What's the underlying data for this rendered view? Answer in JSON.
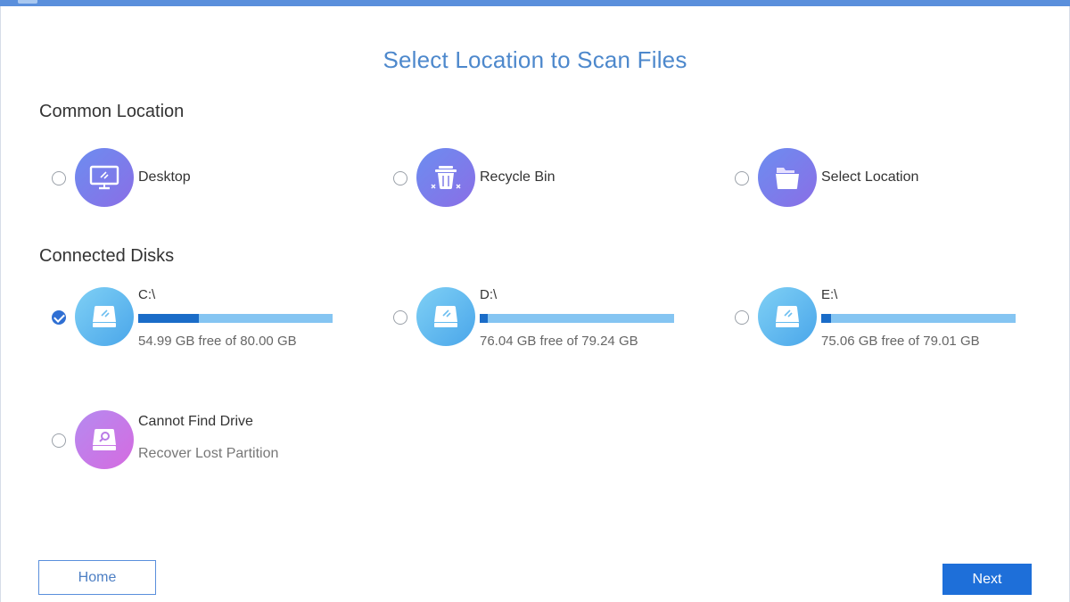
{
  "page": {
    "title": "Select Location to Scan Files"
  },
  "common": {
    "heading": "Common Location",
    "items": [
      {
        "label": "Desktop",
        "icon": "monitor-icon",
        "selected": false
      },
      {
        "label": "Recycle Bin",
        "icon": "recycle-bin-icon",
        "selected": false
      },
      {
        "label": "Select Location",
        "icon": "folder-icon",
        "selected": false
      }
    ]
  },
  "disks": {
    "heading": "Connected Disks",
    "items": [
      {
        "name": "C:\\",
        "free_text": "54.99 GB free of 80.00 GB",
        "used_fraction": 0.31,
        "selected": true,
        "icon": "hard-drive-icon"
      },
      {
        "name": "D:\\",
        "free_text": "76.04 GB free of 79.24 GB",
        "used_fraction": 0.04,
        "selected": false,
        "icon": "hard-drive-icon"
      },
      {
        "name": "E:\\",
        "free_text": "75.06 GB free of 79.01 GB",
        "used_fraction": 0.05,
        "selected": false,
        "icon": "hard-drive-icon"
      }
    ],
    "lost": {
      "title": "Cannot Find Drive",
      "subtitle": "Recover Lost Partition",
      "icon": "drive-search-icon",
      "selected": false
    }
  },
  "buttons": {
    "home": "Home",
    "next": "Next"
  },
  "colors": {
    "accent": "#1e6fd9",
    "title": "#4d88cc",
    "bar_used": "#1a6cc8",
    "bar_free": "#85c5f2"
  }
}
